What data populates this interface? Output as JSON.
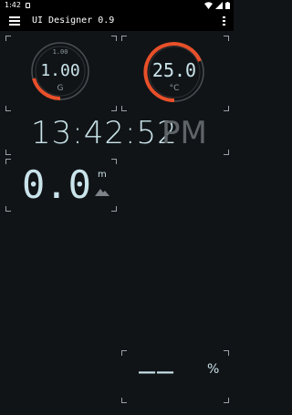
{
  "status_bar": {
    "time": "1:42"
  },
  "app_bar": {
    "title": "UI Designer 0.9"
  },
  "gauges": [
    {
      "top_label": "1.00",
      "value": "1.00",
      "unit": "G",
      "arc_color": "#e8502a",
      "level": 0.35
    },
    {
      "top_label": "",
      "value": "25.0",
      "unit": "°C",
      "arc_color": "#e8502a",
      "level": 0.75
    }
  ],
  "clock": {
    "time": "13:42:52",
    "ampm": "PM"
  },
  "altitude": {
    "value": "0.0",
    "unit": "m"
  },
  "percent": {
    "value": "——",
    "unit": "%"
  },
  "colors": {
    "accent": "#e8502a",
    "text": "#c9e4ea",
    "background": "#111417"
  }
}
